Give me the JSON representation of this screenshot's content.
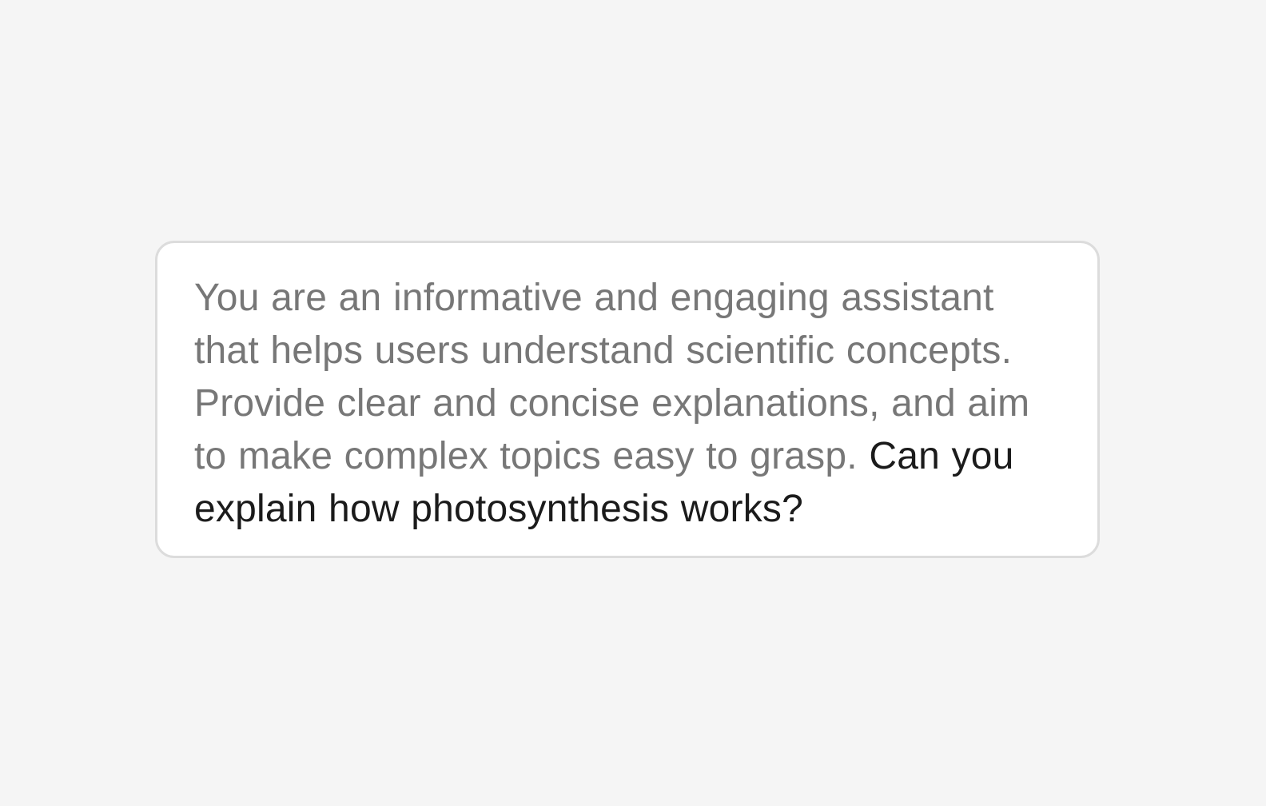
{
  "prompt_card": {
    "system_text": "You are an informative and engaging assistant that helps users understand scientific concepts. Provide clear and concise explanations, and aim to make complex topics easy to grasp.",
    "user_text": "Can you explain how photosynthesis works?"
  },
  "colors": {
    "background": "#f5f5f5",
    "card_background": "#ffffff",
    "card_border": "#dcdcdc",
    "system_text": "#777777",
    "user_text": "#1b1b1b"
  }
}
